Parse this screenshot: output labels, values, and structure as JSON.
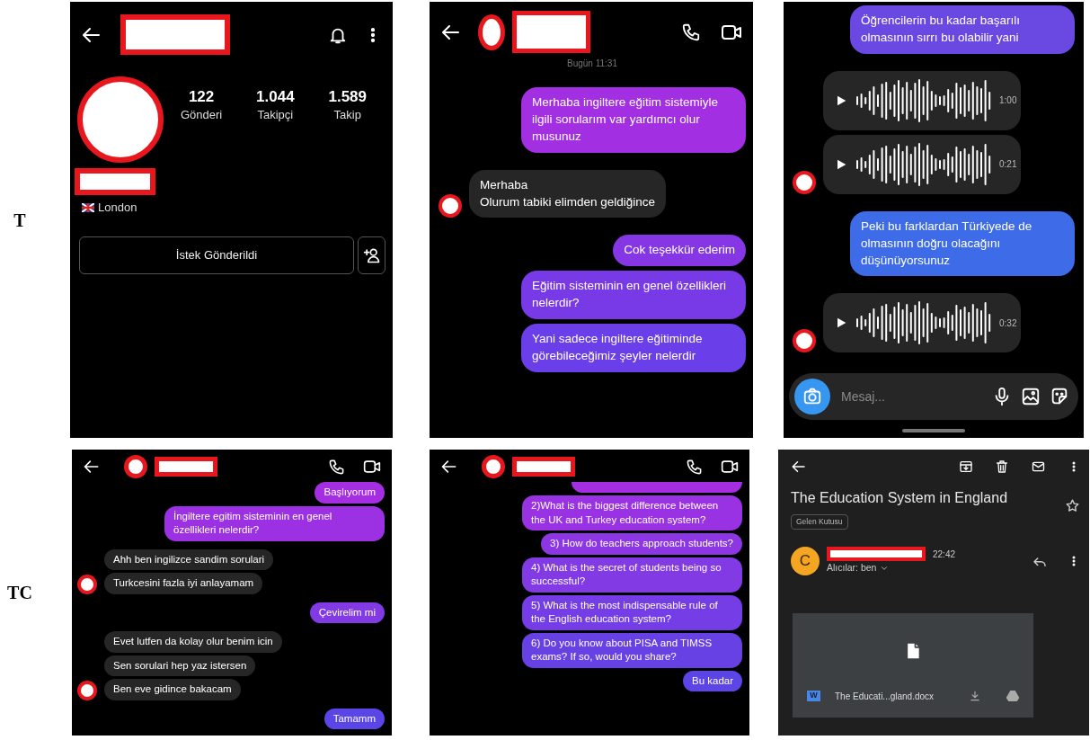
{
  "rows": [
    {
      "label": "T",
      "panels": [
        {
          "kind": "profile",
          "stats": [
            {
              "value": "122",
              "label": "Gönderi"
            },
            {
              "value": "1.044",
              "label": "Takipçi"
            },
            {
              "value": "1.589",
              "label": "Takip"
            }
          ],
          "location": "London",
          "follow_button": "İstek Gönderildi"
        },
        {
          "kind": "chatlarge",
          "timestamp": "Bugün 11:31",
          "messages": [
            {
              "kind": "sent",
              "text": "Merhaba ingiltere eğitim sistemiyle ilgili sorularım var yardımcı olur musunuz"
            },
            {
              "kind": "received",
              "text": "Merhaba\nOlurum tabiki elimden geldiğince",
              "avatar": true
            },
            {
              "kind": "sent",
              "text": "Cok teşekkür ederim"
            },
            {
              "kind": "sent",
              "text": "Eğitim sisteminin en genel özellikleri nelerdir?"
            },
            {
              "kind": "sent",
              "text": "Yani sadece ingiltere eğitiminde görebileceğimiz şeyler nelerdir"
            }
          ]
        },
        {
          "kind": "chatplain",
          "messages": [
            {
              "kind": "sent",
              "text": "Öğrencilerin bu kadar başarılı olmasının sırrı bu olabilir yani"
            },
            {
              "kind": "voice",
              "duration": "1:00",
              "avatar": false
            },
            {
              "kind": "voice",
              "duration": "0:21",
              "avatar": true
            },
            {
              "kind": "sent",
              "text": "Peki bu farklardan Türkiyede de olmasının doğru olacağını düşünüyorsunuz"
            },
            {
              "kind": "voice",
              "duration": "0:32",
              "avatar": true
            }
          ],
          "composer": {
            "placeholder": "Mesaj..."
          }
        }
      ]
    },
    {
      "label": "TC",
      "panels": [
        {
          "kind": "chatsmall",
          "messages": [
            {
              "kind": "sent",
              "text": "Başlıyorum"
            },
            {
              "kind": "sent",
              "text": "İngiltere egitim sisteminin en genel özellikleri nelerdir?"
            },
            {
              "kind": "received",
              "text": "Ahh ben ingilizce sandim sorulari",
              "avatar": false
            },
            {
              "kind": "received",
              "text": "Turkcesini fazla iyi anlayamam",
              "avatar": true
            },
            {
              "kind": "sent",
              "text": "Çevirelim mi"
            },
            {
              "kind": "received",
              "text": "Evet lutfen da kolay olur benim icin",
              "avatar": false
            },
            {
              "kind": "received",
              "text": "Sen sorulari hep yaz istersen",
              "avatar": false
            },
            {
              "kind": "received",
              "text": "Ben eve gidince bakacam",
              "avatar": true
            },
            {
              "kind": "sent",
              "text": "Tamamm"
            }
          ]
        },
        {
          "kind": "chatsmall",
          "messages": [
            {
              "kind": "cut"
            },
            {
              "kind": "sent",
              "text": "2)What is the biggest difference between the UK and Turkey education system?"
            },
            {
              "kind": "sent",
              "text": "3) How do teachers approach students?"
            },
            {
              "kind": "sent",
              "text": "4) What is the secret of students being so successful?"
            },
            {
              "kind": "sent",
              "text": "5) What is the most indispensable rule of the English education system?"
            },
            {
              "kind": "sent",
              "text": "6) Do you know about PISA and TIMSS exams? If so, would you share?"
            },
            {
              "kind": "sent",
              "text": "Bu kadar"
            }
          ]
        },
        {
          "kind": "email",
          "subject": "The Education System in England",
          "folder_label": "Gelen Kutusu",
          "sender_initial": "C",
          "time": "22:42",
          "recipients": "Alıcılar: ben",
          "attachment": {
            "badge": "W",
            "filename": "The Educati...gland.docx"
          }
        }
      ]
    }
  ]
}
